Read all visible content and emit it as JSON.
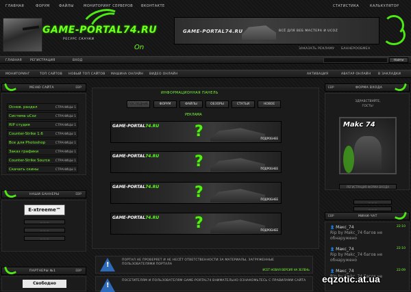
{
  "top_nav": [
    "ГЛАВНАЯ",
    "ФОРУМ",
    "ФАЙЛЫ",
    "МОНИТОРИНГ СЕРВЕРОВ",
    "ВКОНТАКТЕ"
  ],
  "top_right": [
    "СТАТИСТИКА",
    "КАЛЬКУЛЯТОР"
  ],
  "logo": {
    "brand": "GAME-PORTAL74.RU",
    "slogan": "РЕСУРС СКАЧКИ",
    "mark": "On"
  },
  "banner": {
    "title": "GAME-PORTAL74.RU",
    "subtitle": "ВСЁ ДЛЯ ВЕБ МАСТЕРА И UCOZ"
  },
  "banner_links": [
    "ЗАКАЗАТЬ РЕКЛАМУ",
    "БАННЕРООБМЕН"
  ],
  "search": {
    "placeholder": "",
    "button": "Найти"
  },
  "second_nav": [
    "ГЛАВНАЯ",
    "РЕГИСТРАЦИЯ",
    "ВХОД"
  ],
  "third_nav": [
    "МОНИТОРИНГ",
    "ТОП САЙТОВ",
    "НОВЫЙ ТОП САЙТОВ",
    "МАШИНА ОНЛАЙН",
    "ВИДЕО ОНЛАЙН"
  ],
  "third_nav_right": [
    "АКТИВАЦИЯ",
    "АВАТАР ОНЛАЙН",
    "В ЗАКЛАДКИ"
  ],
  "left_menu": {
    "title": "МЕНЮ САЙТА",
    "badge": "ЕВР",
    "items": [
      {
        "name": "Основ. раздел",
        "pages": "СТРАНИЦЫ 1"
      },
      {
        "name": "Система uCoz",
        "pages": "СТРАНИЦЫ 1"
      },
      {
        "name": "RIP студия",
        "pages": "СТРАНИЦЫ 1"
      },
      {
        "name": "Counter-Strike 1.6",
        "pages": "СТРАНИЦЫ 1"
      },
      {
        "name": "Все для Photoshop",
        "pages": "СТРАНИЦЫ 1"
      },
      {
        "name": "Заказ графики",
        "pages": "СТРАНИЦЫ 1"
      },
      {
        "name": "Counter-Strike Source",
        "pages": "СТРАНИЦЫ 1"
      },
      {
        "name": "Скачать скины",
        "pages": "СТРАНИЦЫ 1"
      }
    ]
  },
  "banners_panel": {
    "title": "НАШИ БАННЕРЫ",
    "badge": "ЕВР",
    "banner_text": "E-xtreeme™",
    "buttons": [
      "— — —",
      "— — —",
      "— — —"
    ]
  },
  "partners_panel": {
    "title": "ПАРТНЕРЫ №1",
    "badge": "ЕВР",
    "free_label": "Свободно"
  },
  "center": {
    "title": "ИНФОРМАЦИОННАЯ ПАНЕЛЬ",
    "tabs": [
      "ПОСЛЕДНИЕ",
      "ФОРУМ",
      "ФАЙЛЫ",
      "ОБЗОРЫ",
      "СТАТЬИ",
      "НОВОЕ"
    ],
    "ads_title": "РЕКЛАМА",
    "ads": [
      {
        "brand": "GAME-PORTAL",
        "tld": "74.RU",
        "q": "?",
        "link": "ПОДРОБНЕЕ"
      },
      {
        "brand": "GAME-PORTAL",
        "tld": "74.RU",
        "q": "?",
        "link": "ПОДРОБНЕЕ"
      },
      {
        "brand": "GAME-PORTAL",
        "tld": "74.RU",
        "q": "?",
        "link": "ПОДРОБНЕЕ"
      },
      {
        "brand": "GAME-PORTAL",
        "tld": "74.RU",
        "q": "?",
        "link": "ПОДРОБНЕЕ"
      }
    ],
    "news": [
      {
        "text": "ПОРТАЛ НЕ ПРОВЕРЯЕТ И НЕ НЕСЁТ ОТВЕТСТВЕННОСТИ ЗА МАТЕРИАЛЫ, ЗАГРУЖЕННЫЕ ПОЛЬЗОВАТЕЛЯМИ ПОРТАЛА",
        "footer": "ИСЕТ НОВАЯ ВЕРСИЯ НА ЗЕЛЕНЬ"
      },
      {
        "text": "ПОСЕТИТЕЛЯМ И ПОЛЬЗОВАТЕЛЯМ GAME-PORTAL74 ВНИМАТЕЛЬНО ОЗНАКОМЬТЕСЬ С ПРАВИЛАМИ САЙТА",
        "footer": ""
      }
    ]
  },
  "right_login": {
    "title": "ФОРМА ВХОДА",
    "badge": "ЕВР",
    "greeting": "ЗДРАВСТВУЙТЕ, ГОСТЬ!",
    "avatar_text": "Makc 74",
    "button": "РЕГИСТРАЦИЯ ФОРМА ВХОДА"
  },
  "right_buttons": [
    "— — —",
    "— — —"
  ],
  "chat": {
    "title": "МИНИ-ЧАТ",
    "badge": "ЕВР",
    "messages": [
      {
        "user": "Макс_74",
        "time": "22:10",
        "text": "Rip by Makc_74 багов не обнаружено"
      },
      {
        "user": "Макс_74",
        "time": "22:10",
        "text": "Rip by Makc_74 багов не обнаружено"
      },
      {
        "user": "Макс_74",
        "time": "22:09",
        "text": "Rip by Makc_74 багов не"
      }
    ]
  },
  "watermark": "eqzotic.at.ua",
  "colors": {
    "accent": "#5cff1a",
    "bg": "#151515",
    "panel": "#1b1b1b"
  }
}
